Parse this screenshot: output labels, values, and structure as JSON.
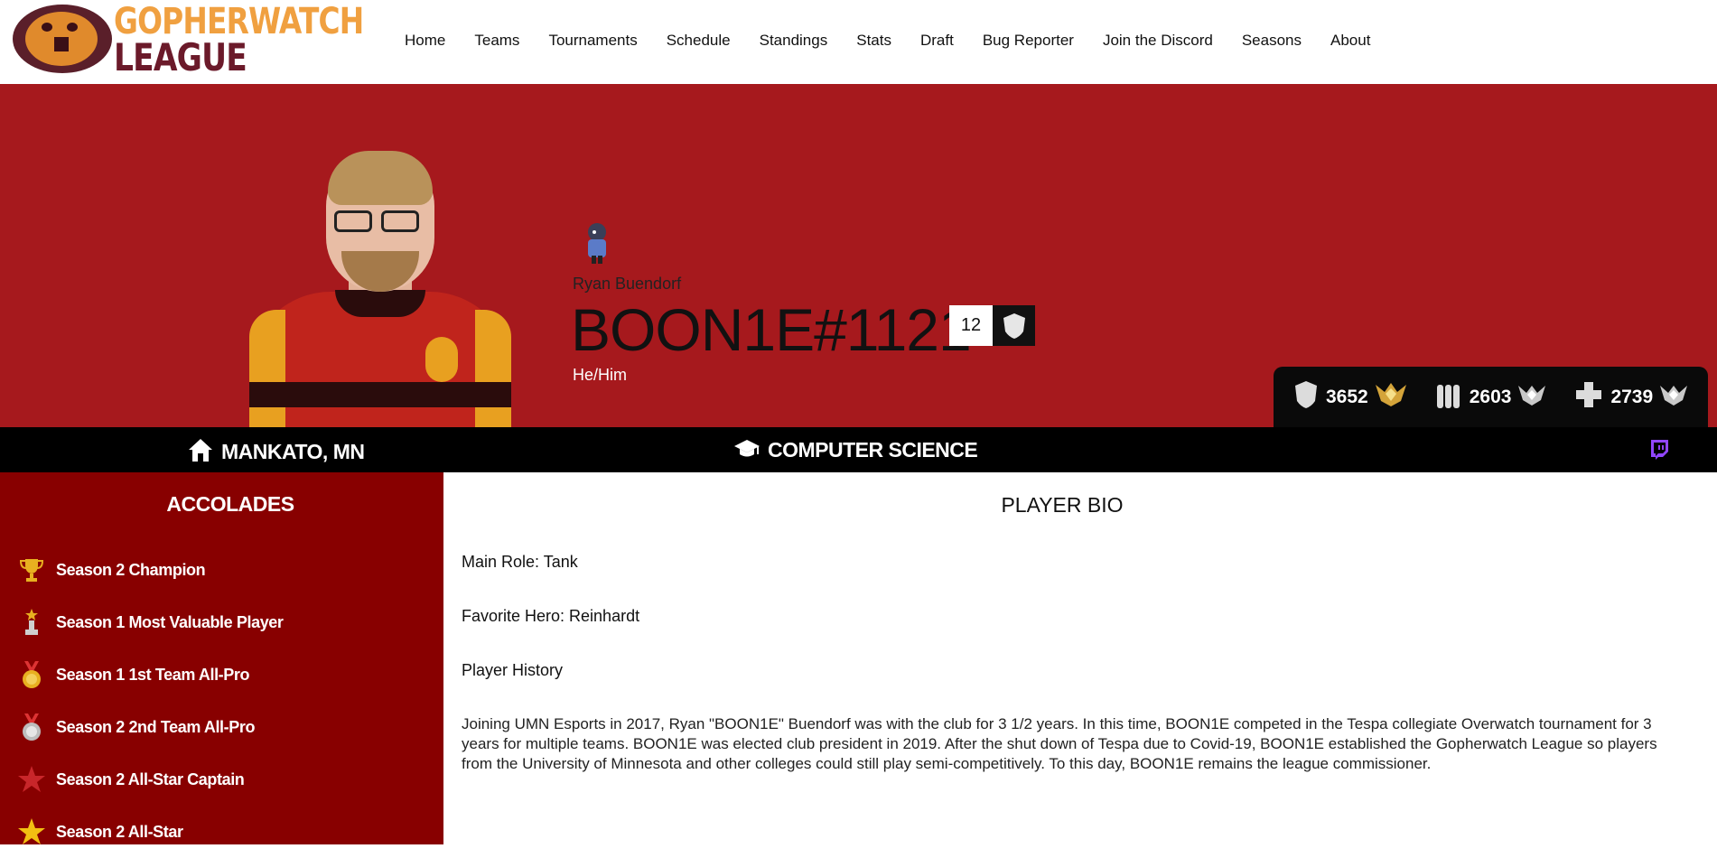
{
  "brand": {
    "line1": "GOPHERWATCH",
    "line2": "LEAGUE",
    "accent_color": "#f0a040",
    "primary_color": "#6b1a2a"
  },
  "nav": {
    "items": [
      "Home",
      "Teams",
      "Tournaments",
      "Schedule",
      "Standings",
      "Stats",
      "Draft",
      "Bug Reporter",
      "Join the Discord",
      "Seasons",
      "About"
    ]
  },
  "player": {
    "real_name": "Ryan Buendorf",
    "gamertag": "BOON1E#1121",
    "jersey_number": "12",
    "pronouns": "He/Him",
    "hometown": "MANKATO, MN",
    "major": "COMPUTER SCIENCE",
    "hero_color": "#a6191d"
  },
  "ranks": [
    {
      "role": "tank",
      "icon": "shield-icon",
      "value": "3652",
      "tier_icon": "gold-rank-icon"
    },
    {
      "role": "damage",
      "icon": "ammo-icon",
      "value": "2603",
      "tier_icon": "silver-rank-icon"
    },
    {
      "role": "support",
      "icon": "cross-icon",
      "value": "2739",
      "tier_icon": "silver-rank-icon"
    }
  ],
  "accolades": {
    "title": "ACCOLADES",
    "items": [
      {
        "label": "Season 2 Champion",
        "icon": "trophy-icon"
      },
      {
        "label": "Season 1 Most Valuable Player",
        "icon": "mvp-award-icon"
      },
      {
        "label": "Season 1 1st Team All-Pro",
        "icon": "gold-medal-icon"
      },
      {
        "label": "Season 2 2nd Team All-Pro",
        "icon": "silver-medal-icon"
      },
      {
        "label": "Season 2 All-Star Captain",
        "icon": "red-star-icon"
      },
      {
        "label": "Season 2 All-Star",
        "icon": "gold-star-icon"
      }
    ]
  },
  "bio": {
    "title": "PLAYER BIO",
    "main_role": "Main Role: Tank",
    "favorite_hero": "Favorite Hero: Reinhardt",
    "history_heading": "Player History",
    "history_text": "Joining UMN Esports in 2017, Ryan \"BOON1E\" Buendorf was with the club for 3 1/2 years. In this time, BOON1E competed in the Tespa collegiate Overwatch tournament for 3 years for multiple teams. BOON1E was elected club president in 2019. After the shut down of Tespa due to Covid-19, BOON1E established the Gopherwatch League so players from the University of Minnesota and other colleges could still play semi-competitively. To this day, BOON1E remains the league commissioner."
  }
}
